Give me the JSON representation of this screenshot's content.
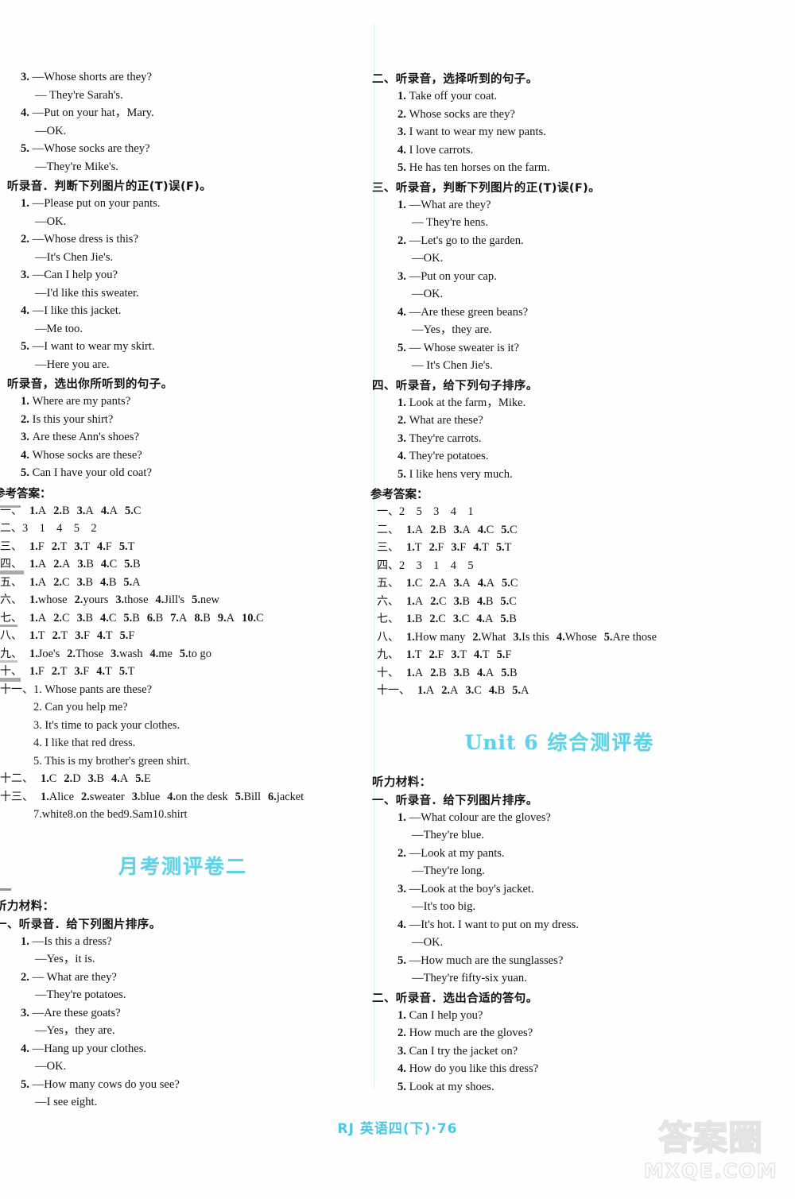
{
  "page": {
    "footer": "RJ 英语四(下)·76",
    "watermark_cn": "答案圈",
    "watermark_en": "MXQE.COM"
  },
  "left_column": {
    "cont_listening_part1": [
      {
        "num": "3.",
        "text": "—Whose shorts are they?"
      },
      {
        "sub": true,
        "text": "— They're Sarah's."
      },
      {
        "num": "4.",
        "text": "—Put on your hat，Mary."
      },
      {
        "sub": true,
        "text": "—OK."
      },
      {
        "num": "5.",
        "text": "—Whose socks are they?"
      },
      {
        "sub": true,
        "text": "—They're Mike's."
      }
    ],
    "section_tf_head": "、听录音．判断下列图片的正(T)误(F)。",
    "section_tf_items": [
      {
        "num": "1.",
        "text": "—Please put on your pants."
      },
      {
        "sub": true,
        "text": "—OK."
      },
      {
        "num": "2.",
        "text": "—Whose dress is this?"
      },
      {
        "sub": true,
        "text": "—It's Chen Jie's."
      },
      {
        "num": "3.",
        "text": "—Can I help you?"
      },
      {
        "sub": true,
        "text": "—I'd like this sweater."
      },
      {
        "num": "4.",
        "text": "—I like this jacket."
      },
      {
        "sub": true,
        "text": "—Me too."
      },
      {
        "num": "5.",
        "text": "—I want to wear my skirt."
      },
      {
        "sub": true,
        "text": "—Here you are."
      }
    ],
    "section_choose_head": "、听录音，选出你所听到的句子。",
    "section_choose_items": [
      {
        "num": "1.",
        "text": "Where are my pants?"
      },
      {
        "num": "2.",
        "text": "Is this your shirt?"
      },
      {
        "num": "3.",
        "text": "Are these Ann's shoes?"
      },
      {
        "num": "4.",
        "text": "Whose socks are these?"
      },
      {
        "num": "5.",
        "text": "Can I have your old coat?"
      }
    ],
    "answers_head": "参考答案：",
    "answers": [
      {
        "cn": "一、",
        "items": [
          [
            "1.",
            "A"
          ],
          [
            "2.",
            "B"
          ],
          [
            "3.",
            "A"
          ],
          [
            "4.",
            "A"
          ],
          [
            "5.",
            "C"
          ]
        ]
      },
      {
        "cn": "二、",
        "plain": "3　1　4　5　2"
      },
      {
        "cn": "三、",
        "items": [
          [
            "1.",
            "F"
          ],
          [
            "2.",
            "T"
          ],
          [
            "3.",
            "T"
          ],
          [
            "4.",
            "F"
          ],
          [
            "5.",
            "T"
          ]
        ]
      },
      {
        "cn": "四、",
        "items": [
          [
            "1.",
            "A"
          ],
          [
            "2.",
            "A"
          ],
          [
            "3.",
            "B"
          ],
          [
            "4.",
            "C"
          ],
          [
            "5.",
            "B"
          ]
        ]
      },
      {
        "cn": "五、",
        "items": [
          [
            "1.",
            "A"
          ],
          [
            "2.",
            "C"
          ],
          [
            "3.",
            "B"
          ],
          [
            "4.",
            "B"
          ],
          [
            "5.",
            "A"
          ]
        ]
      },
      {
        "cn": "六、",
        "items": [
          [
            "1.",
            "whose"
          ],
          [
            "2.",
            "yours"
          ],
          [
            "3.",
            "those"
          ],
          [
            "4.",
            "Jill's"
          ],
          [
            "5.",
            "new"
          ]
        ]
      },
      {
        "cn": "七、",
        "items": [
          [
            "1.",
            "A"
          ],
          [
            "2.",
            "C"
          ],
          [
            "3.",
            "B"
          ],
          [
            "4.",
            "C"
          ],
          [
            "5.",
            "B"
          ],
          [
            "6.",
            "B"
          ],
          [
            "7.",
            "A"
          ],
          [
            "8.",
            "B"
          ],
          [
            "9.",
            "A"
          ],
          [
            "10.",
            "C"
          ]
        ]
      },
      {
        "cn": "八、",
        "items": [
          [
            "1.",
            "T"
          ],
          [
            "2.",
            "T"
          ],
          [
            "3.",
            "F"
          ],
          [
            "4.",
            "T"
          ],
          [
            "5.",
            "F"
          ]
        ]
      },
      {
        "cn": "九、",
        "items": [
          [
            "1.",
            "Joe's"
          ],
          [
            "2.",
            "Those"
          ],
          [
            "3.",
            "wash"
          ],
          [
            "4.",
            "me"
          ],
          [
            "5.",
            "to go"
          ]
        ]
      },
      {
        "cn": "十、",
        "items": [
          [
            "1.",
            "F"
          ],
          [
            "2.",
            "T"
          ],
          [
            "3.",
            "F"
          ],
          [
            "4.",
            "T"
          ],
          [
            "5.",
            "T"
          ]
        ]
      }
    ],
    "answer_11_label": "十一、",
    "answer_11_first": "1. Whose pants are these?",
    "answer_11_rest": [
      "2. Can you help me?",
      "3. It's time to pack your clothes.",
      "4. I like that red dress.",
      "5. This is my brother's green shirt."
    ],
    "answer_12": {
      "cn": "十二、",
      "items": [
        [
          "1.",
          "C"
        ],
        [
          "2.",
          "D"
        ],
        [
          "3.",
          "B"
        ],
        [
          "4.",
          "A"
        ],
        [
          "5.",
          "E"
        ]
      ]
    },
    "answer_13": {
      "cn": "十三、",
      "line1": [
        [
          "1.",
          "Alice"
        ],
        [
          "2.",
          "sweater"
        ],
        [
          "3.",
          "blue"
        ],
        [
          "4.",
          "on the desk"
        ],
        [
          "5.",
          "Bill"
        ],
        [
          "6.",
          "jacket"
        ]
      ],
      "line2": [
        [
          "7.",
          "white"
        ],
        [
          "8.",
          "on the bed"
        ],
        [
          "9.",
          "Sam"
        ],
        [
          "10.",
          "shirt"
        ]
      ]
    },
    "paper_title": "月考测评卷二",
    "listening_label": "听力材料：",
    "section1_head": "一、听录音．给下列图片排序。",
    "section1_items": [
      {
        "num": "1.",
        "text": "—Is this a dress?"
      },
      {
        "sub": true,
        "text": "—Yes，it is."
      },
      {
        "num": "2.",
        "text": "— What are they?"
      },
      {
        "sub": true,
        "text": "—They're potatoes."
      },
      {
        "num": "3.",
        "text": "—Are these goats?"
      },
      {
        "sub": true,
        "text": "—Yes，they are."
      },
      {
        "num": "4.",
        "text": "—Hang up your clothes."
      },
      {
        "sub": true,
        "text": "—OK."
      },
      {
        "num": "5.",
        "text": "—How many cows do you see?"
      },
      {
        "sub": true,
        "text": "—I see eight."
      }
    ]
  },
  "right_column": {
    "section2_head": "二、听录音，选择听到的句子。",
    "section2_items": [
      {
        "num": "1.",
        "text": "Take off your coat."
      },
      {
        "num": "2.",
        "text": "Whose socks are they?"
      },
      {
        "num": "3.",
        "text": "I want to wear my new pants."
      },
      {
        "num": "4.",
        "text": "I love carrots."
      },
      {
        "num": "5.",
        "text": "He has ten horses on the farm."
      }
    ],
    "section3_head": "三、听录音，判断下列图片的正(T)误(F)。",
    "section3_items": [
      {
        "num": "1.",
        "text": "—What are they?"
      },
      {
        "sub": true,
        "text": "— They're hens."
      },
      {
        "num": "2.",
        "text": "—Let's go to the garden."
      },
      {
        "sub": true,
        "text": "—OK."
      },
      {
        "num": "3.",
        "text": "—Put on your cap."
      },
      {
        "sub": true,
        "text": "—OK."
      },
      {
        "num": "4.",
        "text": "—Are these green beans?"
      },
      {
        "sub": true,
        "text": "—Yes，they are."
      },
      {
        "num": "5.",
        "text": "— Whose sweater is it?"
      },
      {
        "sub": true,
        "text": "— It's Chen Jie's."
      }
    ],
    "section4_head": "四、听录音，给下列句子排序。",
    "section4_items": [
      {
        "num": "1.",
        "text": "Look at the farm，Mike."
      },
      {
        "num": "2.",
        "text": "What are these?"
      },
      {
        "num": "3.",
        "text": "They're carrots."
      },
      {
        "num": "4.",
        "text": "They're potatoes."
      },
      {
        "num": "5.",
        "text": "I like hens very much."
      }
    ],
    "answers_head": "参考答案：",
    "answers": [
      {
        "cn": "一、",
        "plain": "2　5　3　4　1"
      },
      {
        "cn": "二、",
        "items": [
          [
            "1.",
            "A"
          ],
          [
            "2.",
            "B"
          ],
          [
            "3.",
            "A"
          ],
          [
            "4.",
            "C"
          ],
          [
            "5.",
            "C"
          ]
        ]
      },
      {
        "cn": "三、",
        "items": [
          [
            "1.",
            "T"
          ],
          [
            "2.",
            "F"
          ],
          [
            "3.",
            "F"
          ],
          [
            "4.",
            "T"
          ],
          [
            "5.",
            "T"
          ]
        ]
      },
      {
        "cn": "四、",
        "plain": "2　3　1　4　5"
      },
      {
        "cn": "五、",
        "items": [
          [
            "1.",
            "C"
          ],
          [
            "2.",
            "A"
          ],
          [
            "3.",
            "A"
          ],
          [
            "4.",
            "A"
          ],
          [
            "5.",
            "C"
          ]
        ]
      },
      {
        "cn": "六、",
        "items": [
          [
            "1.",
            "A"
          ],
          [
            "2.",
            "C"
          ],
          [
            "3.",
            "B"
          ],
          [
            "4.",
            "B"
          ],
          [
            "5.",
            "C"
          ]
        ]
      },
      {
        "cn": "七、",
        "items": [
          [
            "1.",
            "B"
          ],
          [
            "2.",
            "C"
          ],
          [
            "3.",
            "C"
          ],
          [
            "4.",
            "A"
          ],
          [
            "5.",
            "B"
          ]
        ]
      },
      {
        "cn": "八、",
        "items": [
          [
            "1.",
            "How many"
          ],
          [
            "2.",
            "What"
          ],
          [
            "3.",
            "Is this"
          ],
          [
            "4.",
            "Whose"
          ],
          [
            "5.",
            "Are those"
          ]
        ]
      },
      {
        "cn": "九、",
        "items": [
          [
            "1.",
            "T"
          ],
          [
            "2.",
            "F"
          ],
          [
            "3.",
            "T"
          ],
          [
            "4.",
            "T"
          ],
          [
            "5.",
            "F"
          ]
        ]
      },
      {
        "cn": "十、",
        "items": [
          [
            "1.",
            "A"
          ],
          [
            "2.",
            "B"
          ],
          [
            "3.",
            "B"
          ],
          [
            "4.",
            "A"
          ],
          [
            "5.",
            "B"
          ]
        ]
      },
      {
        "cn": "十一、",
        "items": [
          [
            "1.",
            "A"
          ],
          [
            "2.",
            "A"
          ],
          [
            "3.",
            "C"
          ],
          [
            "4.",
            "B"
          ],
          [
            "5.",
            "A"
          ]
        ]
      }
    ],
    "paper_title_en": "Unit 6",
    "paper_title_cn": "综合测评卷",
    "listening_label": "听力材料：",
    "u6_section1_head": "一、听录音．给下列图片排序。",
    "u6_section1_items": [
      {
        "num": "1.",
        "text": "—What colour are the gloves?"
      },
      {
        "sub": true,
        "text": "—They're blue."
      },
      {
        "num": "2.",
        "text": "—Look at my pants."
      },
      {
        "sub": true,
        "text": "—They're long."
      },
      {
        "num": "3.",
        "text": "—Look at the boy's jacket."
      },
      {
        "sub": true,
        "text": "—It's too big."
      },
      {
        "num": "4.",
        "text": "—It's hot. I want to put on my dress."
      },
      {
        "sub": true,
        "text": "—OK."
      },
      {
        "num": "5.",
        "text": "—How much are the sunglasses?"
      },
      {
        "sub": true,
        "text": "—They're fifty-six yuan."
      }
    ],
    "u6_section2_head": "二、听录音．选出合适的答句。",
    "u6_section2_items": [
      {
        "num": "1.",
        "text": "Can I help you?"
      },
      {
        "num": "2.",
        "text": "How much are the gloves?"
      },
      {
        "num": "3.",
        "text": "Can I try the jacket on?"
      },
      {
        "num": "4.",
        "text": "How do you like this dress?"
      },
      {
        "num": "5.",
        "text": "Look at my shoes."
      }
    ]
  }
}
